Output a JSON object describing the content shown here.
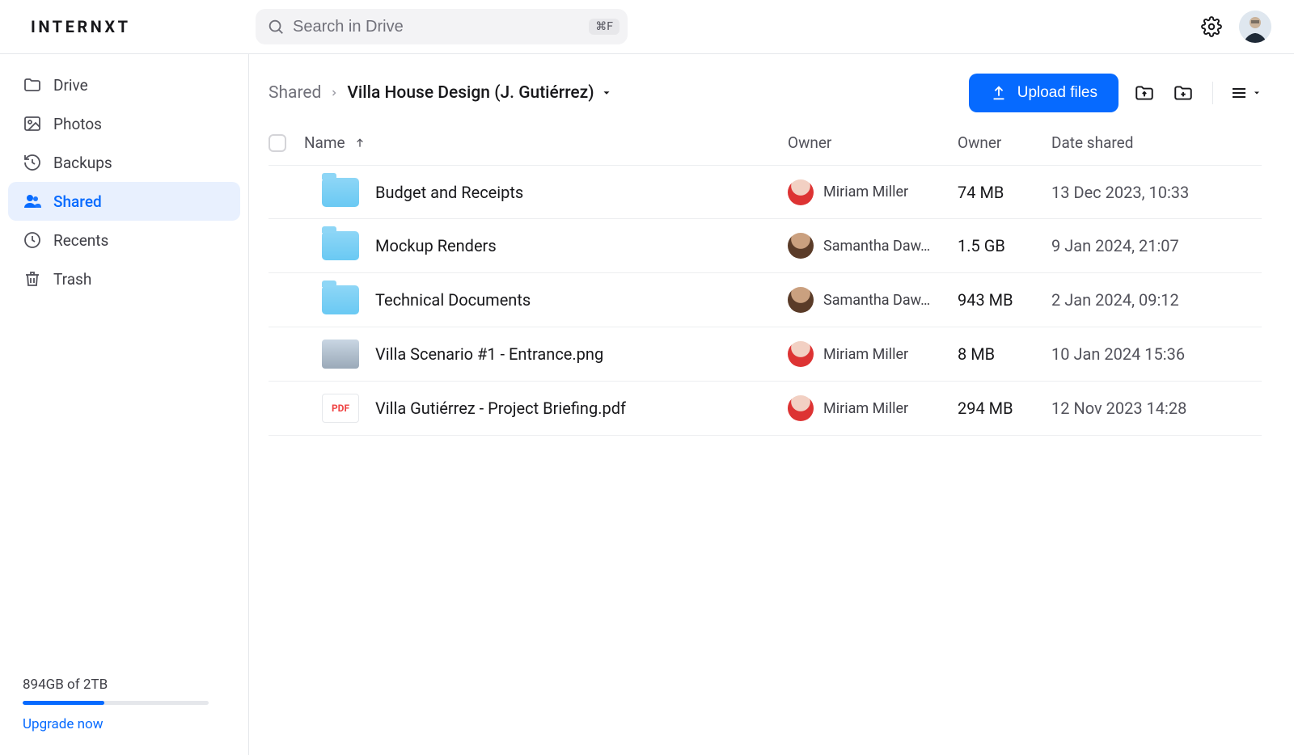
{
  "app": {
    "logo_text": "INTERNXT"
  },
  "search": {
    "placeholder": "Search in Drive",
    "shortcut": "⌘F"
  },
  "sidebar": {
    "items": [
      {
        "key": "drive",
        "label": "Drive"
      },
      {
        "key": "photos",
        "label": "Photos"
      },
      {
        "key": "backups",
        "label": "Backups"
      },
      {
        "key": "shared",
        "label": "Shared"
      },
      {
        "key": "recents",
        "label": "Recents"
      },
      {
        "key": "trash",
        "label": "Trash"
      }
    ],
    "active_key": "shared",
    "storage_text": "894GB of 2TB",
    "storage_percent": 44,
    "upgrade_label": "Upgrade now"
  },
  "breadcrumb": {
    "root": "Shared",
    "current": "Villa House Design (J. Gutiérrez)"
  },
  "toolbar": {
    "upload_label": "Upload files"
  },
  "columns": {
    "name": "Name",
    "owner": "Owner",
    "size": "Owner",
    "date": "Date shared"
  },
  "rows": [
    {
      "kind": "folder",
      "name": "Budget and Receipts",
      "owner": "Miriam Miller",
      "owner_avatar": "red",
      "size": "74 MB",
      "date": "13 Dec 2023, 10:33"
    },
    {
      "kind": "folder",
      "name": "Mockup Renders",
      "owner": "Samantha Daw…",
      "owner_avatar": "brown",
      "size": "1.5 GB",
      "date": "9 Jan 2024, 21:07"
    },
    {
      "kind": "folder",
      "name": "Technical Documents",
      "owner": "Samantha Daw…",
      "owner_avatar": "brown",
      "size": "943 MB",
      "date": "2 Jan 2024, 09:12"
    },
    {
      "kind": "image",
      "name": "Villa Scenario #1 - Entrance.png",
      "owner": "Miriam Miller",
      "owner_avatar": "red",
      "size": "8 MB",
      "date": "10 Jan 2024 15:36"
    },
    {
      "kind": "pdf",
      "name": "Villa Gutiérrez - Project Briefing.pdf",
      "owner": "Miriam Miller",
      "owner_avatar": "red",
      "size": "294 MB",
      "date": "12 Nov 2023 14:28"
    }
  ]
}
